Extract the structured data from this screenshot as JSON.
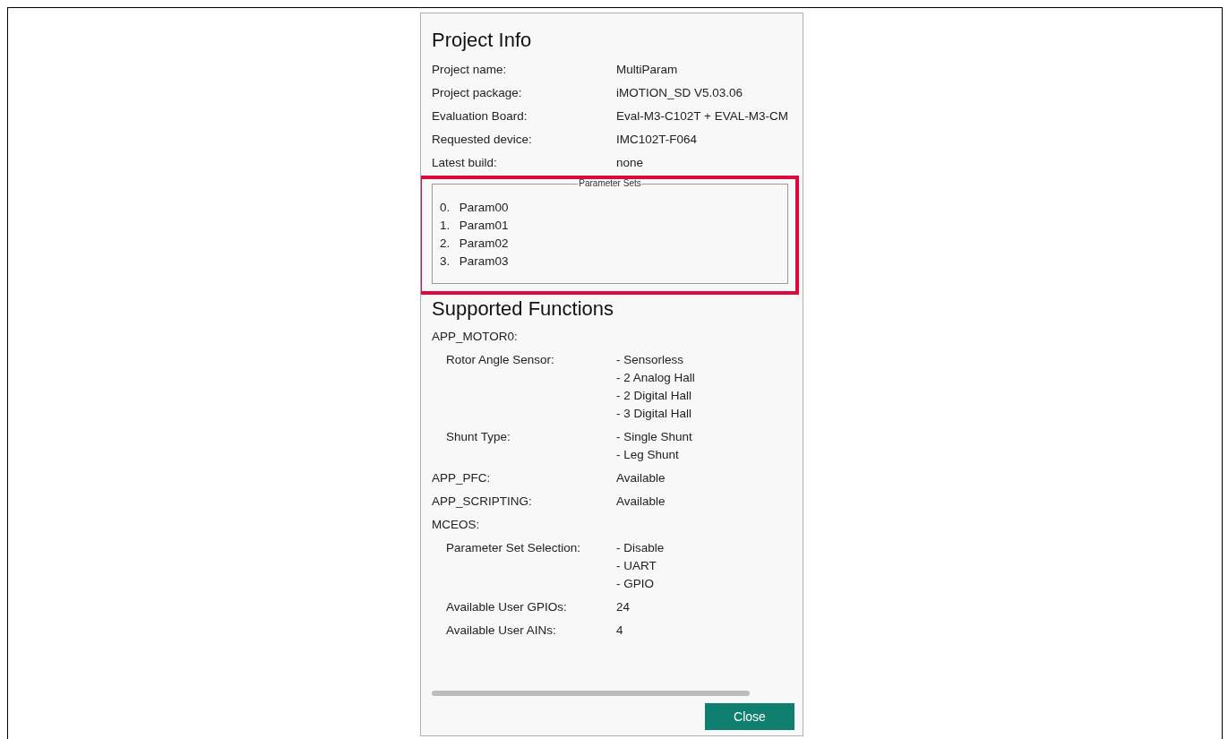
{
  "project_info": {
    "title": "Project Info",
    "fields": [
      {
        "label": "Project name:",
        "value": "MultiParam"
      },
      {
        "label": "Project package:",
        "value": "iMOTION_SD V5.03.06"
      },
      {
        "label": "Evaluation Board:",
        "value": "Eval-M3-C102T + EVAL-M3-CM"
      },
      {
        "label": "Requested device:",
        "value": "IMC102T-F064"
      },
      {
        "label": "Latest build:",
        "value": "none"
      }
    ]
  },
  "parameter_sets": {
    "title": "Parameter Sets",
    "items": [
      {
        "index": "0.",
        "name": "Param00"
      },
      {
        "index": "1.",
        "name": "Param01"
      },
      {
        "index": "2.",
        "name": "Param02"
      },
      {
        "index": "3.",
        "name": "Param03"
      }
    ]
  },
  "supported_functions": {
    "title": "Supported Functions",
    "entries": [
      {
        "label": "APP_MOTOR0:",
        "children": [
          {
            "label": "Rotor Angle Sensor:",
            "values": [
              "- Sensorless",
              "- 2 Analog Hall",
              "- 2 Digital Hall",
              "- 3 Digital Hall"
            ]
          },
          {
            "label": "Shunt Type:",
            "values": [
              "- Single Shunt",
              "- Leg Shunt"
            ]
          }
        ]
      },
      {
        "label": "APP_PFC:",
        "values": [
          "Available"
        ]
      },
      {
        "label": "APP_SCRIPTING:",
        "values": [
          "Available"
        ]
      },
      {
        "label": "MCEOS:",
        "children": [
          {
            "label": "Parameter Set Selection:",
            "values": [
              "- Disable",
              "- UART",
              "- GPIO"
            ]
          },
          {
            "label": "Available User GPIOs:",
            "values": [
              "24"
            ]
          },
          {
            "label": "Available User AINs:",
            "values": [
              "4"
            ]
          }
        ]
      }
    ]
  },
  "close_button": {
    "label": "Close"
  }
}
